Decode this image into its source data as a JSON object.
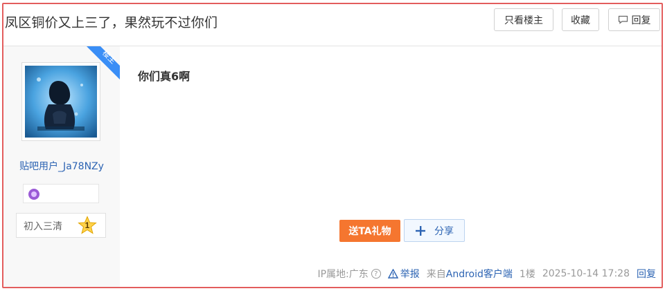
{
  "thread": {
    "title": "凤区铜价又上三了，果然玩不过你们"
  },
  "header_buttons": {
    "only_op": "只看楼主",
    "collect": "收藏",
    "reply": "回复"
  },
  "author": {
    "badge": "楼主",
    "username": "贴吧用户_Ja78NZy",
    "rank_title": "初入三清",
    "rank_level": "1"
  },
  "post": {
    "content": "你们真6啊"
  },
  "actions": {
    "gift": "送TA礼物",
    "share": "分享"
  },
  "meta": {
    "ip": "IP属地:广东",
    "report": "举报",
    "source_prefix": "来自",
    "source_client": "Android客户端",
    "floor": "1楼",
    "time": "2025-10-14 17:28",
    "reply": "回复"
  },
  "colors": {
    "frame_border": "#e35d5d",
    "link_blue": "#2d64b3",
    "gift_orange": "#f5762f",
    "badge_blue": "#3a8ef6"
  }
}
